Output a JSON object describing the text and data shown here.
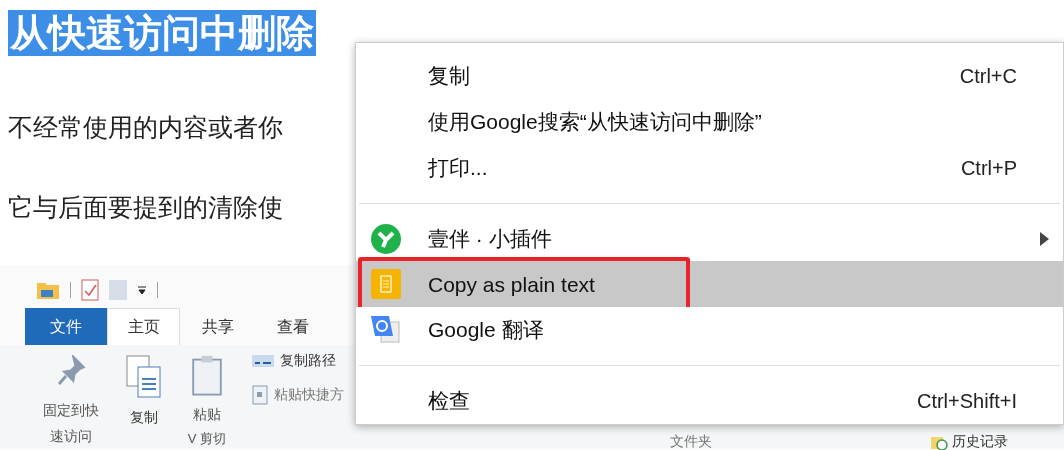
{
  "article": {
    "heading": {
      "text": "从快速访问中删除",
      "selected": true
    },
    "paragraphs": [
      "不经常使用的内容或者你",
      "它与后面要提到的清除使"
    ]
  },
  "explorer_screenshot": {
    "ribbon_tabs": [
      {
        "label": "文件",
        "kind": "file",
        "selected": false
      },
      {
        "label": "主页",
        "kind": "tab",
        "selected": true
      },
      {
        "label": "共享",
        "kind": "tab",
        "selected": false
      },
      {
        "label": "查看",
        "kind": "tab",
        "selected": false
      }
    ],
    "pin_label": [
      "固定到快",
      "速访问"
    ],
    "copy_label": "复制",
    "paste_label": "粘贴",
    "cut_label": "V 剪切",
    "copy_path_label": "复制路径",
    "paste_shortcut_label": "粘贴快捷方",
    "folder_label": "文件夹",
    "history_label": "历史记录"
  },
  "context_menu": {
    "items": [
      {
        "kind": "command",
        "label": "复制",
        "shortcut": "Ctrl+C",
        "highlighted": false
      },
      {
        "kind": "command",
        "label": "使用Google搜索“从快速访问中删除”",
        "highlighted": false
      },
      {
        "kind": "command",
        "label": "打印...",
        "shortcut": "Ctrl+P",
        "highlighted": false
      },
      {
        "kind": "separator"
      },
      {
        "kind": "command",
        "label": "壹伴 · 小插件",
        "submenu": true,
        "highlighted": false
      },
      {
        "kind": "command",
        "label": "Copy as plain text",
        "highlighted": true,
        "annotated": true
      },
      {
        "kind": "command",
        "label": "Google 翻译",
        "highlighted": false
      },
      {
        "kind": "separator"
      },
      {
        "kind": "command",
        "label": "检查",
        "shortcut": "Ctrl+Shift+I",
        "highlighted": false
      }
    ]
  }
}
